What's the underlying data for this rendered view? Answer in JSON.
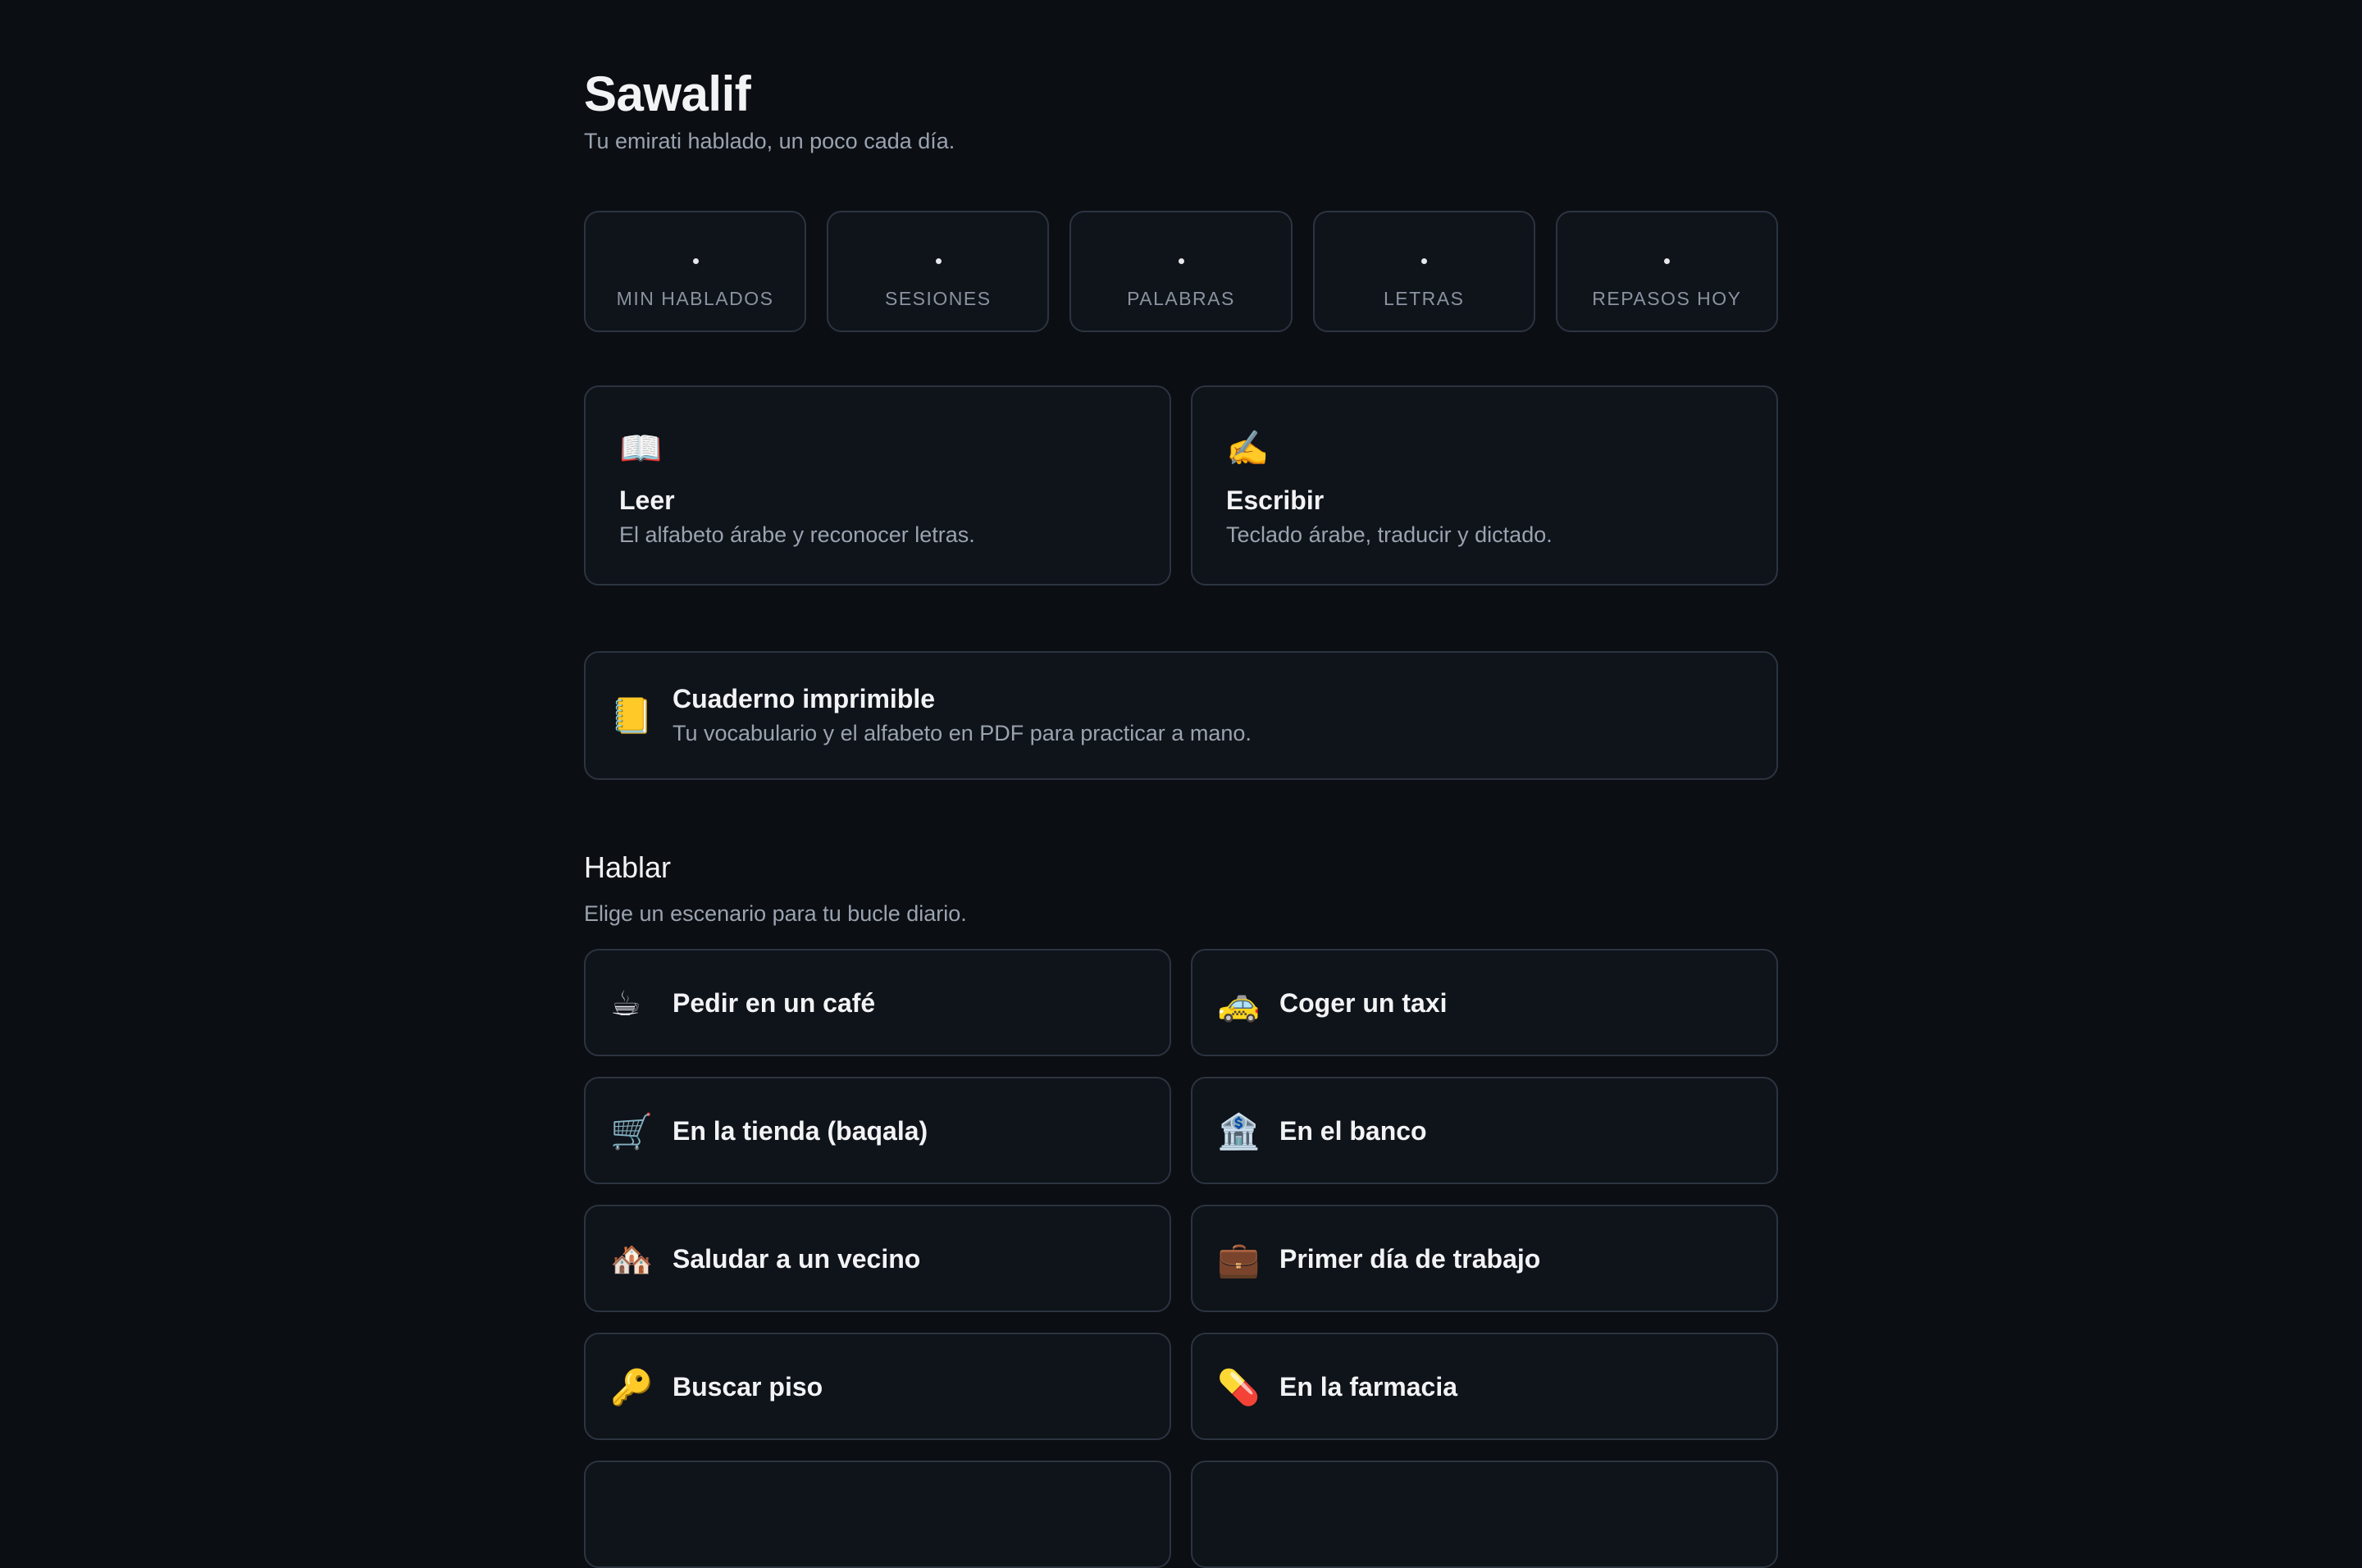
{
  "header": {
    "title": "Sawalif",
    "subtitle": "Tu emirati hablado, un poco cada día."
  },
  "stats": [
    {
      "label": "MIN HABLADOS"
    },
    {
      "label": "SESIONES"
    },
    {
      "label": "PALABRAS"
    },
    {
      "label": "LETRAS"
    },
    {
      "label": "REPASOS HOY"
    }
  ],
  "modules": [
    {
      "icon": "📖",
      "icon_name": "open-book-icon",
      "title": "Leer",
      "description": "El alfabeto árabe y reconocer letras."
    },
    {
      "icon": "✍️",
      "icon_name": "writing-hand-icon",
      "title": "Escribir",
      "description": "Teclado árabe, traducir y dictado."
    }
  ],
  "notebook": {
    "icon": "📒",
    "icon_name": "notebook-icon",
    "title": "Cuaderno imprimible",
    "description": "Tu vocabulario y el alfabeto en PDF para practicar a mano."
  },
  "speak": {
    "title": "Hablar",
    "description": "Elige un escenario para tu bucle diario.",
    "scenarios": [
      {
        "icon": "☕",
        "icon_name": "coffee-icon",
        "label": "Pedir en un café"
      },
      {
        "icon": "🚕",
        "icon_name": "taxi-icon",
        "label": "Coger un taxi"
      },
      {
        "icon": "🛒",
        "icon_name": "shopping-cart-icon",
        "label": "En la tienda (baqala)"
      },
      {
        "icon": "🏦",
        "icon_name": "bank-icon",
        "label": "En el banco"
      },
      {
        "icon": "🏘️",
        "icon_name": "houses-icon",
        "label": "Saludar a un vecino"
      },
      {
        "icon": "💼",
        "icon_name": "briefcase-icon",
        "label": "Primer día de trabajo"
      },
      {
        "icon": "🔑",
        "icon_name": "key-icon",
        "label": "Buscar piso"
      },
      {
        "icon": "💊",
        "icon_name": "pill-icon",
        "label": "En la farmacia"
      },
      {
        "icon": "",
        "icon_name": "",
        "label": ""
      },
      {
        "icon": "",
        "icon_name": "",
        "label": ""
      }
    ]
  }
}
